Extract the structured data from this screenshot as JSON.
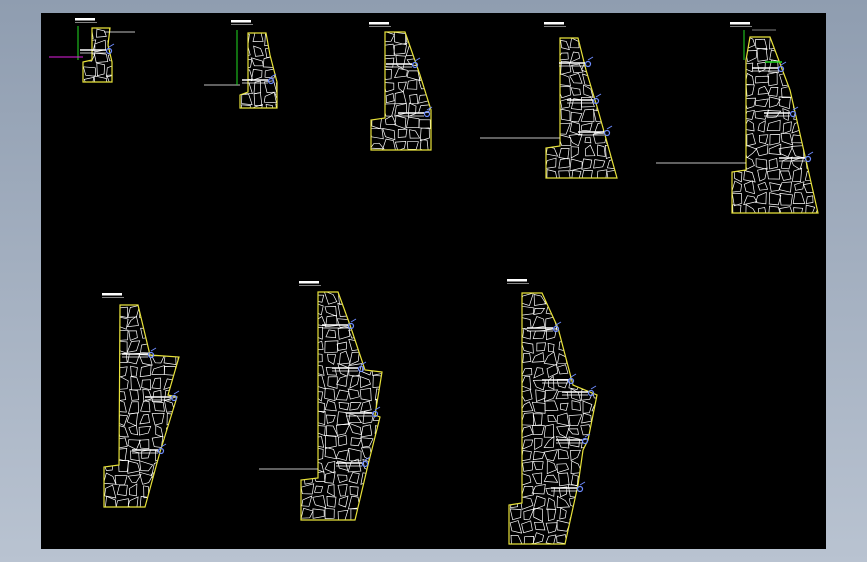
{
  "app": {
    "title": ""
  },
  "colors": {
    "background": "#000000",
    "frame": "#a5b1c2",
    "wall_outline": "#e8e23a",
    "stone_joints": "#ffffff",
    "drain_pipe": "#6e8cff",
    "label": "#ffffff",
    "dimension_green": "#22dd22",
    "leader_magenta": "#e020e0",
    "ground_line": "#ffffff"
  },
  "drawing": {
    "type": "gravity retaining wall cross-sections (masonry)",
    "section_count": 8,
    "sections": [
      {
        "id": "section-1",
        "label": "",
        "drain_outlets": 1,
        "has_dimension_marks": true
      },
      {
        "id": "section-2",
        "label": "",
        "drain_outlets": 1,
        "has_dimension_marks": true
      },
      {
        "id": "section-3",
        "label": "",
        "drain_outlets": 2,
        "has_dimension_marks": false
      },
      {
        "id": "section-4",
        "label": "",
        "drain_outlets": 3,
        "has_dimension_marks": false
      },
      {
        "id": "section-5",
        "label": "",
        "drain_outlets": 3,
        "has_dimension_marks": true
      },
      {
        "id": "section-6",
        "label": "",
        "drain_outlets": 3,
        "has_dimension_marks": false
      },
      {
        "id": "section-7",
        "label": "",
        "drain_outlets": 4,
        "has_dimension_marks": false
      },
      {
        "id": "section-8",
        "label": "",
        "drain_outlets": 5,
        "has_dimension_marks": false
      }
    ]
  }
}
